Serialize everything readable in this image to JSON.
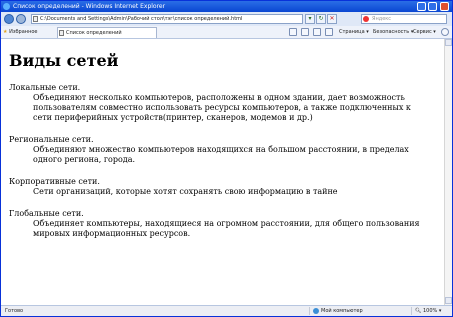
{
  "window": {
    "title": "Список определений - Windows Internet Explorer"
  },
  "address": {
    "url": "C:\\Documents and Settings\\Admin\\Рабочий стол\\тэг\\список определений.html"
  },
  "search": {
    "placeholder": "Яндекс"
  },
  "favorites": {
    "label": "Избранное"
  },
  "tab": {
    "title": "Список определений"
  },
  "toolbar": {
    "page_label": "Страница",
    "security_label": "Безопасность",
    "tools_label": "Сервис"
  },
  "page": {
    "heading": "Виды сетей",
    "definitions": [
      {
        "term": "Локальные сети.",
        "description": "Объединяют несколько компьютеров, расположены в одном здании, дает возможность пользователям совместно использовать ресурсы компьютеров, а также подключенных к сети периферийных устройств(принтер, сканеров, модемов и др.)"
      },
      {
        "term": "Региональные сети.",
        "description": "Объединяют множество компьютеров находящихся на большом расстоянии, в пределах одного региона, города."
      },
      {
        "term": "Корпоративные сети.",
        "description": "Сети организаций, которые хотят сохранять свою информацию в тайне"
      },
      {
        "term": "Глобальные сети.",
        "description": "Объединяет компьютеры, находящиеся на огромном расстоянии, для общего пользования мировых информационных ресурсов."
      }
    ]
  },
  "status": {
    "text": "Готово",
    "zone": "Мой компьютер",
    "zoom": "100%"
  }
}
